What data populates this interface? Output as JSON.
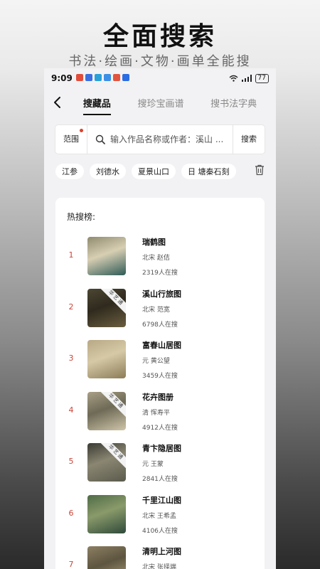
{
  "promo": {
    "title": "全面搜索",
    "subtitle": "书法·绘画·文物·画单全能搜"
  },
  "status_bar": {
    "time": "9:09",
    "battery": "77",
    "notification_colors": [
      "#e34c3a",
      "#3b6fe0",
      "#2aa0d8",
      "#3b8fe8",
      "#e2543f",
      "#2b6de4"
    ]
  },
  "nav": {
    "tabs": [
      "搜藏品",
      "搜珍宝画谱",
      "搜书法字典"
    ],
    "active_tab": 0
  },
  "search": {
    "scope_label": "范围",
    "placeholder": "输入作品名称或作者：溪山 ...",
    "button_label": "搜索"
  },
  "history": {
    "chips": [
      "江参",
      "刘德水",
      "夏景山口",
      "日 塘秦石刻"
    ]
  },
  "hot": {
    "title": "热搜榜:",
    "items": [
      {
        "rank": "1",
        "name": "瑞鹤图",
        "meta": "北宋 赵佶",
        "heat": "2319人在搜",
        "badge": "",
        "colors": [
          "#8f8a6e",
          "#2e5b57",
          "#d8cfb3"
        ]
      },
      {
        "rank": "2",
        "name": "溪山行旅图",
        "meta": "北宋 范宽",
        "heat": "6798人在搜",
        "badge": "华艺通",
        "colors": [
          "#4c4632",
          "#6b5e3f",
          "#2f2a1e"
        ]
      },
      {
        "rank": "3",
        "name": "富春山居图",
        "meta": "元 黄公望",
        "heat": "3459人在搜",
        "badge": "",
        "colors": [
          "#b8a985",
          "#8c7c58",
          "#d6c9a6"
        ]
      },
      {
        "rank": "4",
        "name": "花卉图册",
        "meta": "清 恽寿平",
        "heat": "4912人在搜",
        "badge": "华艺通",
        "colors": [
          "#a99f86",
          "#cfc5a9",
          "#6e6a56"
        ]
      },
      {
        "rank": "5",
        "name": "青卞隐居图",
        "meta": "元 王蒙",
        "heat": "2841人在搜",
        "badge": "华艺通",
        "colors": [
          "#3a3a32",
          "#5b5a4c",
          "#8a8672"
        ]
      },
      {
        "rank": "6",
        "name": "千里江山图",
        "meta": "北宋 王希孟",
        "heat": "4106人在搜",
        "badge": "",
        "colors": [
          "#4f6b47",
          "#2f4a3a",
          "#8a9a6a"
        ]
      },
      {
        "rank": "7",
        "name": "清明上河图",
        "meta": "北宋 张择端",
        "heat": "",
        "badge": "",
        "colors": [
          "#8c7f63",
          "#b3a683",
          "#5e5540"
        ]
      }
    ]
  }
}
